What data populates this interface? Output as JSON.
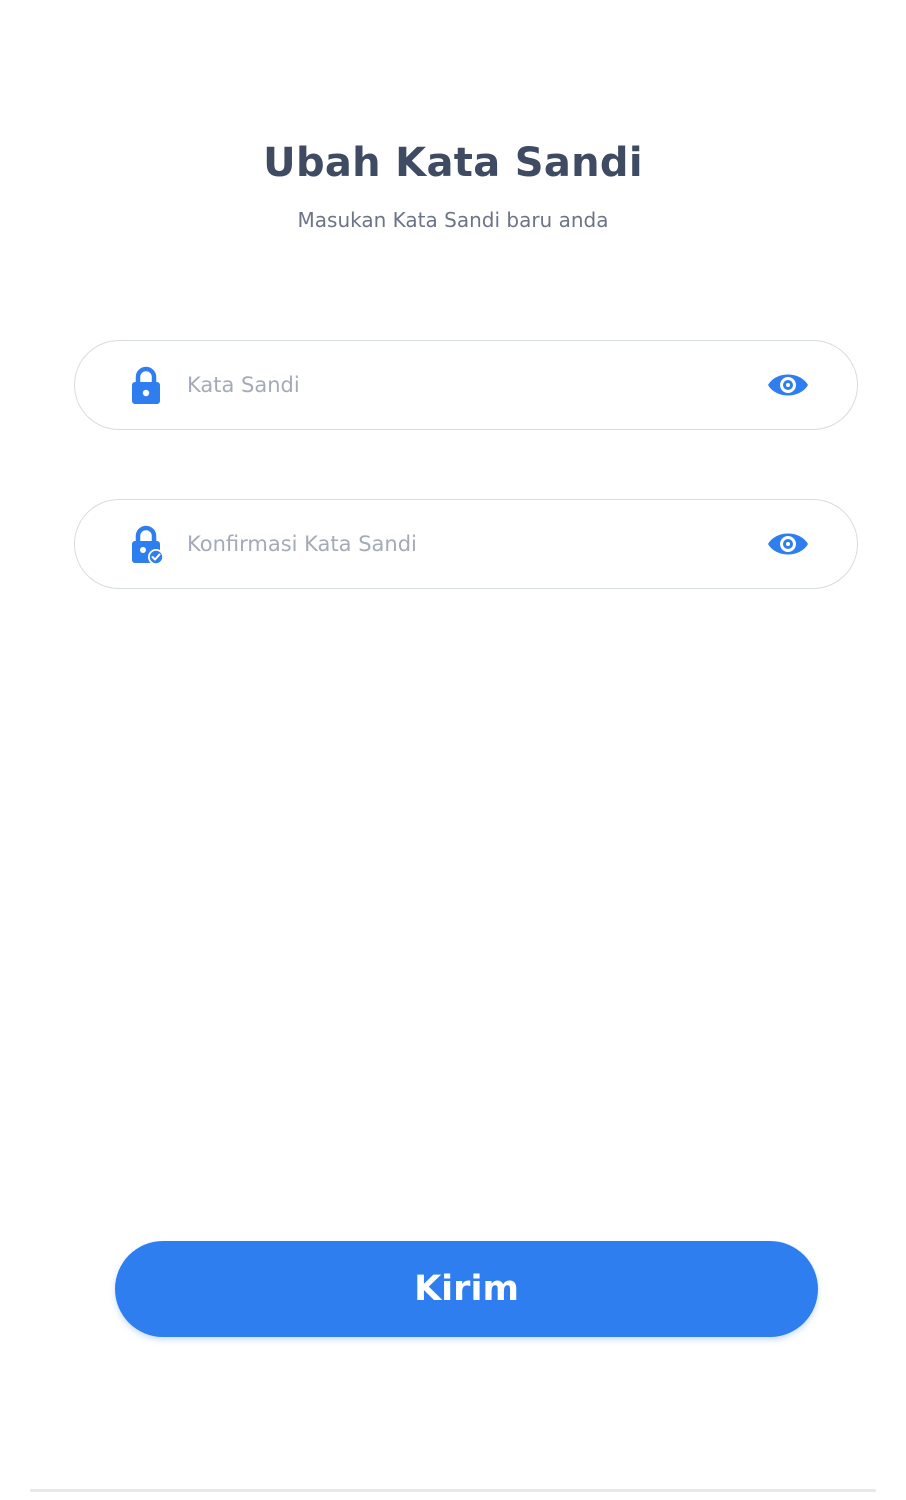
{
  "header": {
    "title": "Ubah Kata Sandi",
    "subtitle": "Masukan Kata Sandi baru anda"
  },
  "form": {
    "password": {
      "placeholder": "Kata Sandi",
      "value": "",
      "lead_icon": "lock-icon",
      "toggle_icon": "eye-icon"
    },
    "confirm_password": {
      "placeholder": "Konfirmasi Kata Sandi",
      "value": "",
      "lead_icon": "lock-check-icon",
      "toggle_icon": "eye-icon"
    },
    "submit_label": "Kirim"
  },
  "colors": {
    "accent": "#2f7ef0",
    "title": "#3f4a63",
    "subtitle": "#6c7487",
    "placeholder": "#a4abb8",
    "field_border": "#d7dce5"
  }
}
